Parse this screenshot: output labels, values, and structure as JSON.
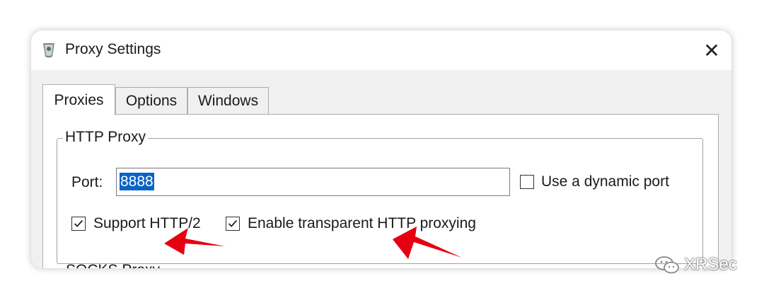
{
  "window": {
    "title": "Proxy Settings",
    "close_symbol": "✕"
  },
  "tabs": [
    {
      "label": "Proxies",
      "active": true
    },
    {
      "label": "Options",
      "active": false
    },
    {
      "label": "Windows",
      "active": false
    }
  ],
  "http_proxy": {
    "group_label": "HTTP Proxy",
    "port_label": "Port:",
    "port_value": "8888",
    "dynamic_port": {
      "label": "Use a dynamic port",
      "checked": false
    },
    "support_http2": {
      "label": "Support HTTP/2",
      "checked": true
    },
    "transparent_proxying": {
      "label": "Enable transparent HTTP proxying",
      "checked": true
    }
  },
  "next_group_label_partial": "SOCKS Proxy",
  "watermark": {
    "text": "XRSec",
    "icon": "wechat-icon"
  },
  "colors": {
    "arrow": "#e60012",
    "selection": "#0a64c8"
  }
}
